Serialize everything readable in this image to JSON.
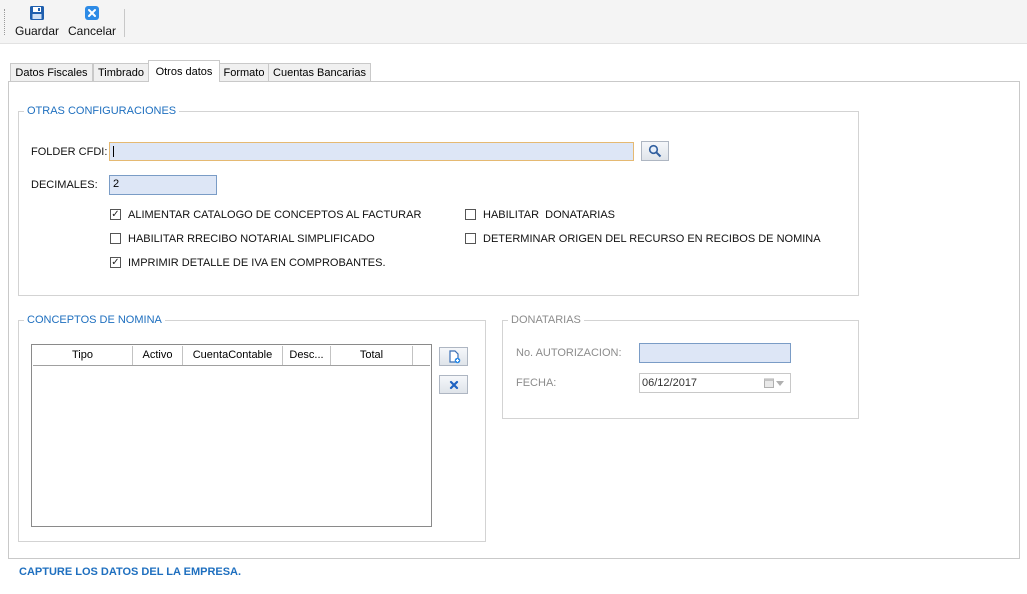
{
  "toolbar": {
    "save_label": "Guardar",
    "cancel_label": "Cancelar",
    "save_icon": "floppy-disk-icon",
    "cancel_icon": "close-icon"
  },
  "tabs": [
    {
      "label": "Datos Fiscales"
    },
    {
      "label": "Timbrado"
    },
    {
      "label": "Otros datos",
      "active": true
    },
    {
      "label": "Formato"
    },
    {
      "label": "Cuentas Bancarias"
    }
  ],
  "otras": {
    "legend": "OTRAS CONFIGURACIONES",
    "folder_label": "FOLDER CFDI:",
    "folder_value": "",
    "decimales_label": "DECIMALES:",
    "decimales_value": "2",
    "checkboxes": [
      {
        "label": "ALIMENTAR CATALOGO DE CONCEPTOS AL FACTURAR",
        "checked": true
      },
      {
        "label": "HABILITAR  DONATARIAS",
        "checked": false
      },
      {
        "label": "HABILITAR RRECIBO NOTARIAL SIMPLIFICADO",
        "checked": false
      },
      {
        "label": "DETERMINAR ORIGEN DEL RECURSO EN RECIBOS DE NOMINA",
        "checked": false
      },
      {
        "label": "IMPRIMIR DETALLE DE IVA EN COMPROBANTES.",
        "checked": true
      }
    ]
  },
  "conceptos": {
    "legend": "CONCEPTOS DE NOMINA",
    "columns": [
      "Tipo",
      "Activo",
      "CuentaContable",
      "Desc...",
      "Total"
    ]
  },
  "donatarias": {
    "legend": "DONATARIAS",
    "autorizacion_label": "No. AUTORIZACION:",
    "autorizacion_value": "",
    "fecha_label": "FECHA:",
    "fecha_value": "06/12/2017"
  },
  "footer": {
    "text": "CAPTURE LOS DATOS DEL LA EMPRESA."
  },
  "colors": {
    "accent": "#1e6fbf",
    "input_bg": "#dde6f6",
    "input_border": "#7a9cc6"
  }
}
